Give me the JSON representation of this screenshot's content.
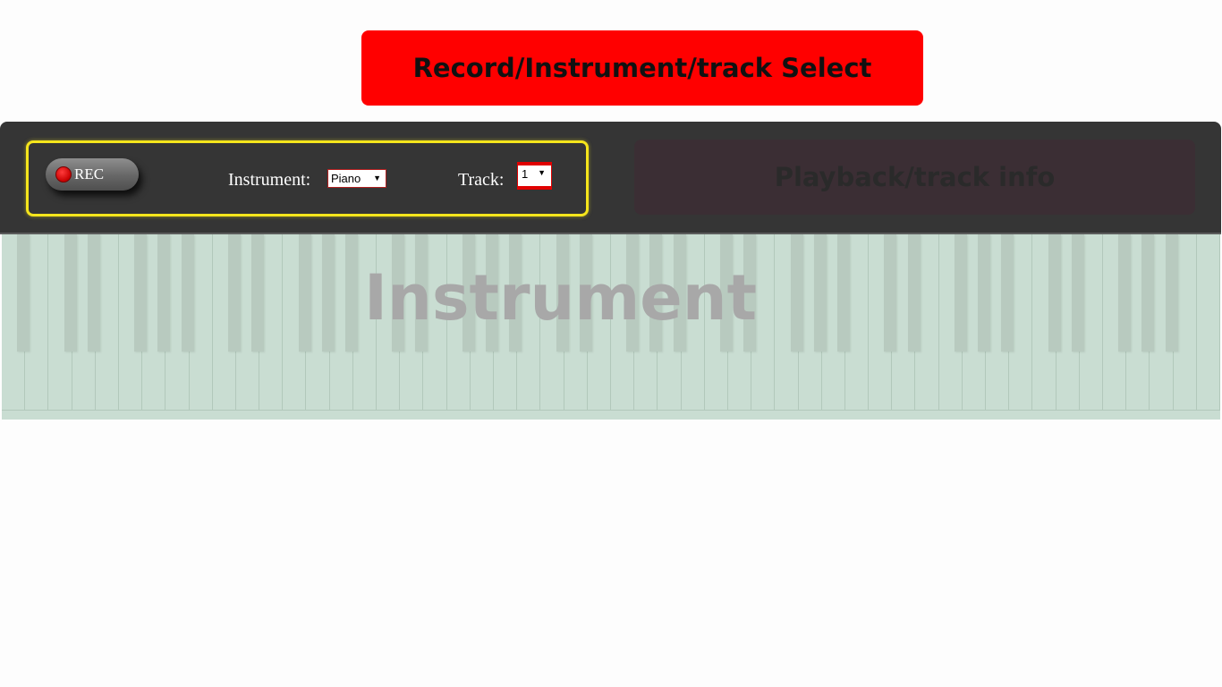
{
  "banner": {
    "title": "Record/Instrument/track Select"
  },
  "controls": {
    "rec_label": "REC",
    "instrument_label": "Instrument:",
    "instrument_value": "Piano",
    "track_label": "Track:",
    "track_value": "1"
  },
  "playback": {
    "title": "Playback/track info"
  },
  "keyboard": {
    "overlay_label": "Instrument",
    "white_key_count": 52,
    "colors": {
      "white": "#c9ddd2",
      "black": "#b8cabf"
    }
  },
  "colors": {
    "banner": "#ff0000",
    "toolbar": "#353535",
    "highlight": "#f5e51c",
    "playback": "#3b2e34"
  }
}
